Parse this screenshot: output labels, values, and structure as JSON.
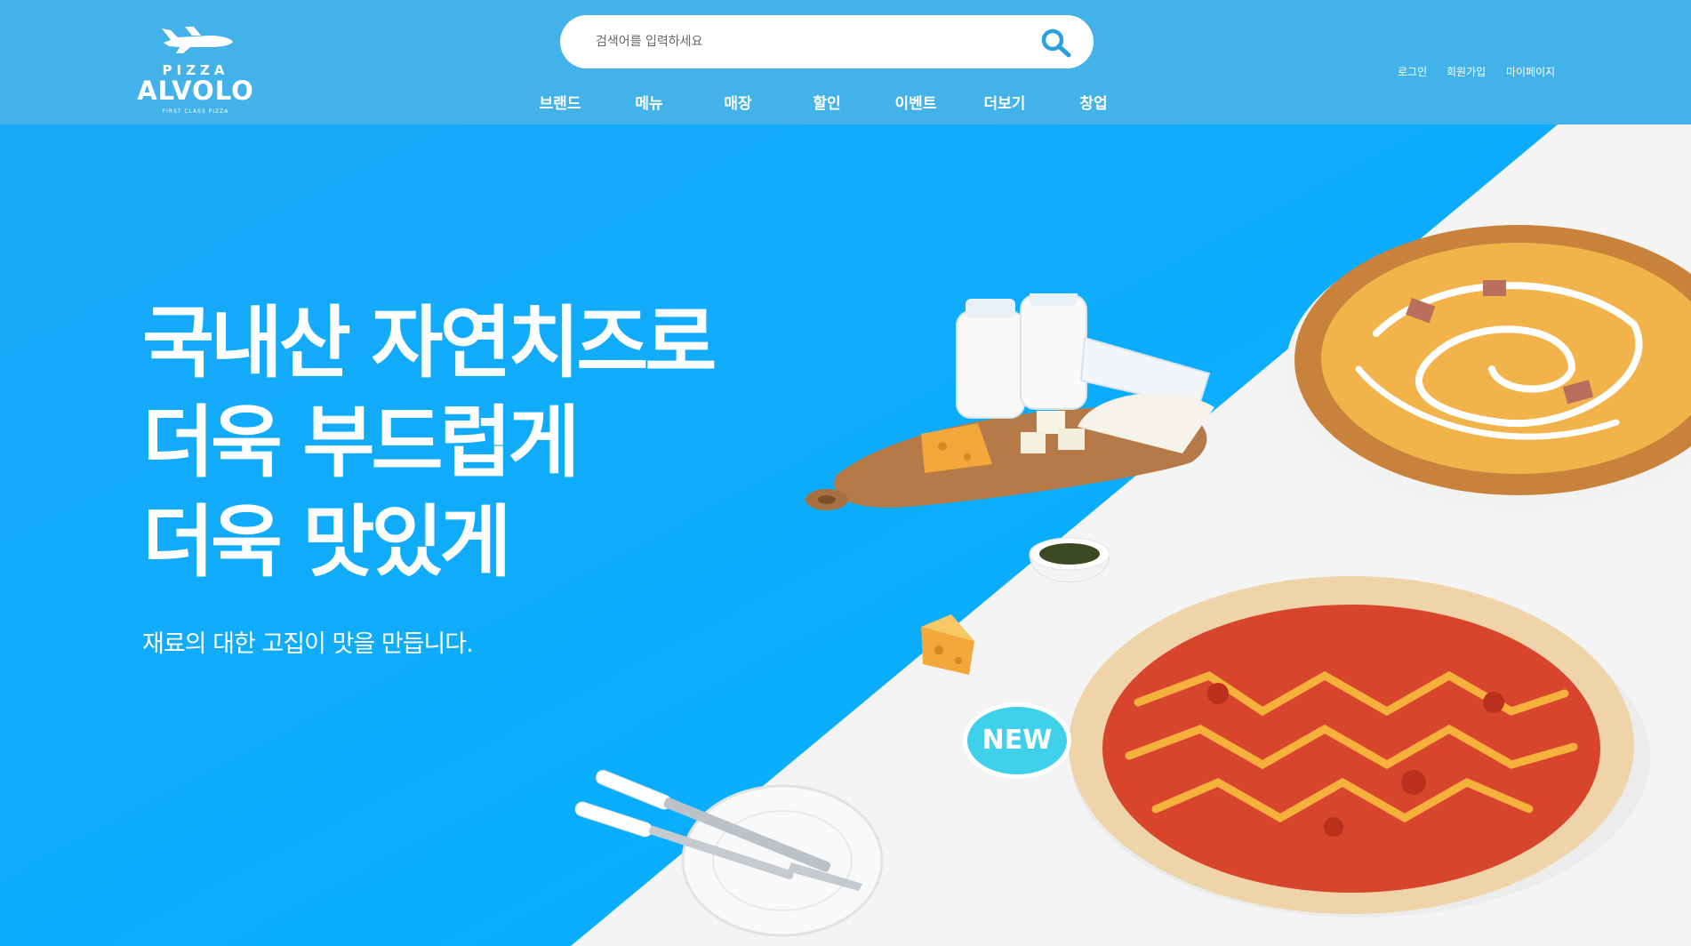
{
  "brand": {
    "top": "PIZZA",
    "name": "ALVOLO",
    "tagline": "FIRST CLASS PIZZA"
  },
  "search": {
    "placeholder": "검색어를 입력하세요",
    "icon": "search-icon"
  },
  "nav": {
    "items": [
      {
        "label": "브랜드"
      },
      {
        "label": "메뉴"
      },
      {
        "label": "매장"
      },
      {
        "label": "할인"
      },
      {
        "label": "이벤트"
      },
      {
        "label": "더보기"
      },
      {
        "label": "창업"
      }
    ]
  },
  "util": {
    "login": "로그인",
    "signup": "회원가입",
    "mypage": "마이페이지"
  },
  "hero": {
    "line1": "국내산 자연치즈로",
    "line2": "더욱 부드럽게",
    "line3": "더욱 맛있게",
    "subtitle": "재료의 대한 고집이 맛을 만듭니다.",
    "badge": "NEW"
  },
  "colors": {
    "header": "#43b2e8",
    "hero_blue": "#16a6f7",
    "badge": "#3fd0ea"
  }
}
